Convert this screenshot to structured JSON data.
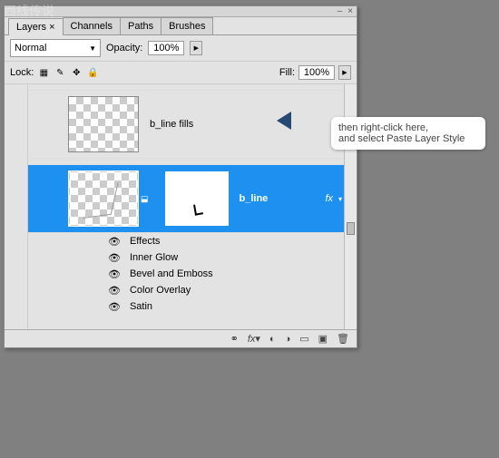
{
  "watermark": "西线传说",
  "window": {
    "minimize": "–",
    "close": "×"
  },
  "tabs": [
    "Layers ×",
    "Channels",
    "Paths",
    "Brushes"
  ],
  "blend": {
    "mode": "Normal"
  },
  "opacity": {
    "label": "Opacity:",
    "value": "100%"
  },
  "lock": {
    "label": "Lock:"
  },
  "fill": {
    "label": "Fill:",
    "value": "100%"
  },
  "layers": {
    "top": {
      "name": "b_line fills"
    },
    "selected": {
      "name": "b_line",
      "fx": "fx"
    }
  },
  "effects": {
    "header": "Effects",
    "items": [
      "Inner Glow",
      "Bevel and Emboss",
      "Color Overlay",
      "Satin"
    ]
  },
  "callout": {
    "line1": "then right-click here,",
    "line2": "and select Paste Layer Style"
  }
}
